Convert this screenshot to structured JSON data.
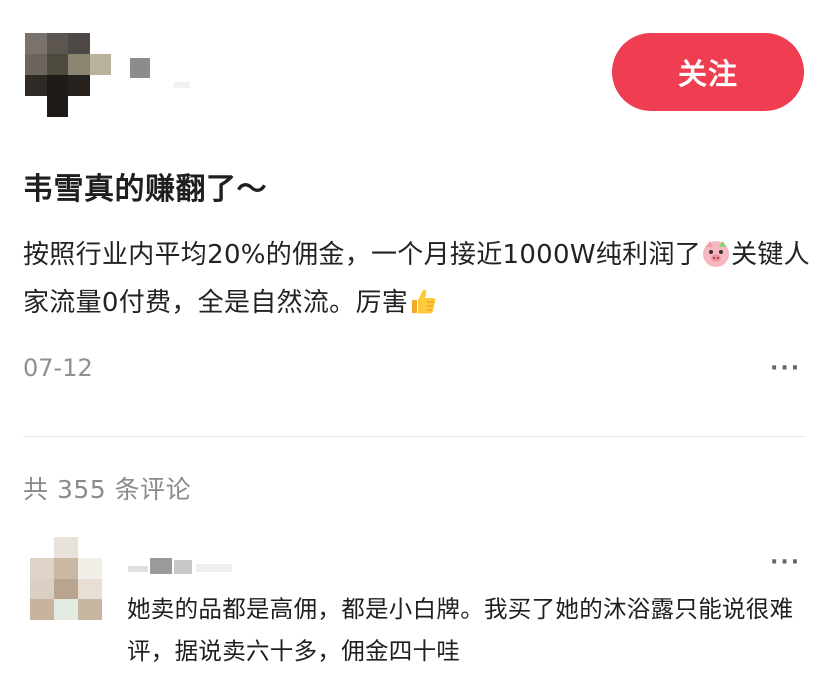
{
  "author": {
    "name_redacted": true,
    "follow_label": "关注",
    "follow_color": "#ef3e51"
  },
  "post": {
    "title": "韦雪真的赚翻了～",
    "body_part1": "按照行业内平均20%的佣金，一个月接近1000W纯利润了",
    "body_part2": "关键人家流量0付费，全是自然流。厉害",
    "emoji_1": "pig-face-emoji",
    "emoji_2": "thumbs-up-emoji",
    "date": "07-12",
    "more_label": "···"
  },
  "comments": {
    "count_label": "共 355 条评论",
    "items": [
      {
        "text": "她卖的品都是高佣，都是小白牌。我买了她的沐浴露只能说很难评，据说卖六十多，佣金四十哇",
        "more_label": "···"
      }
    ]
  }
}
